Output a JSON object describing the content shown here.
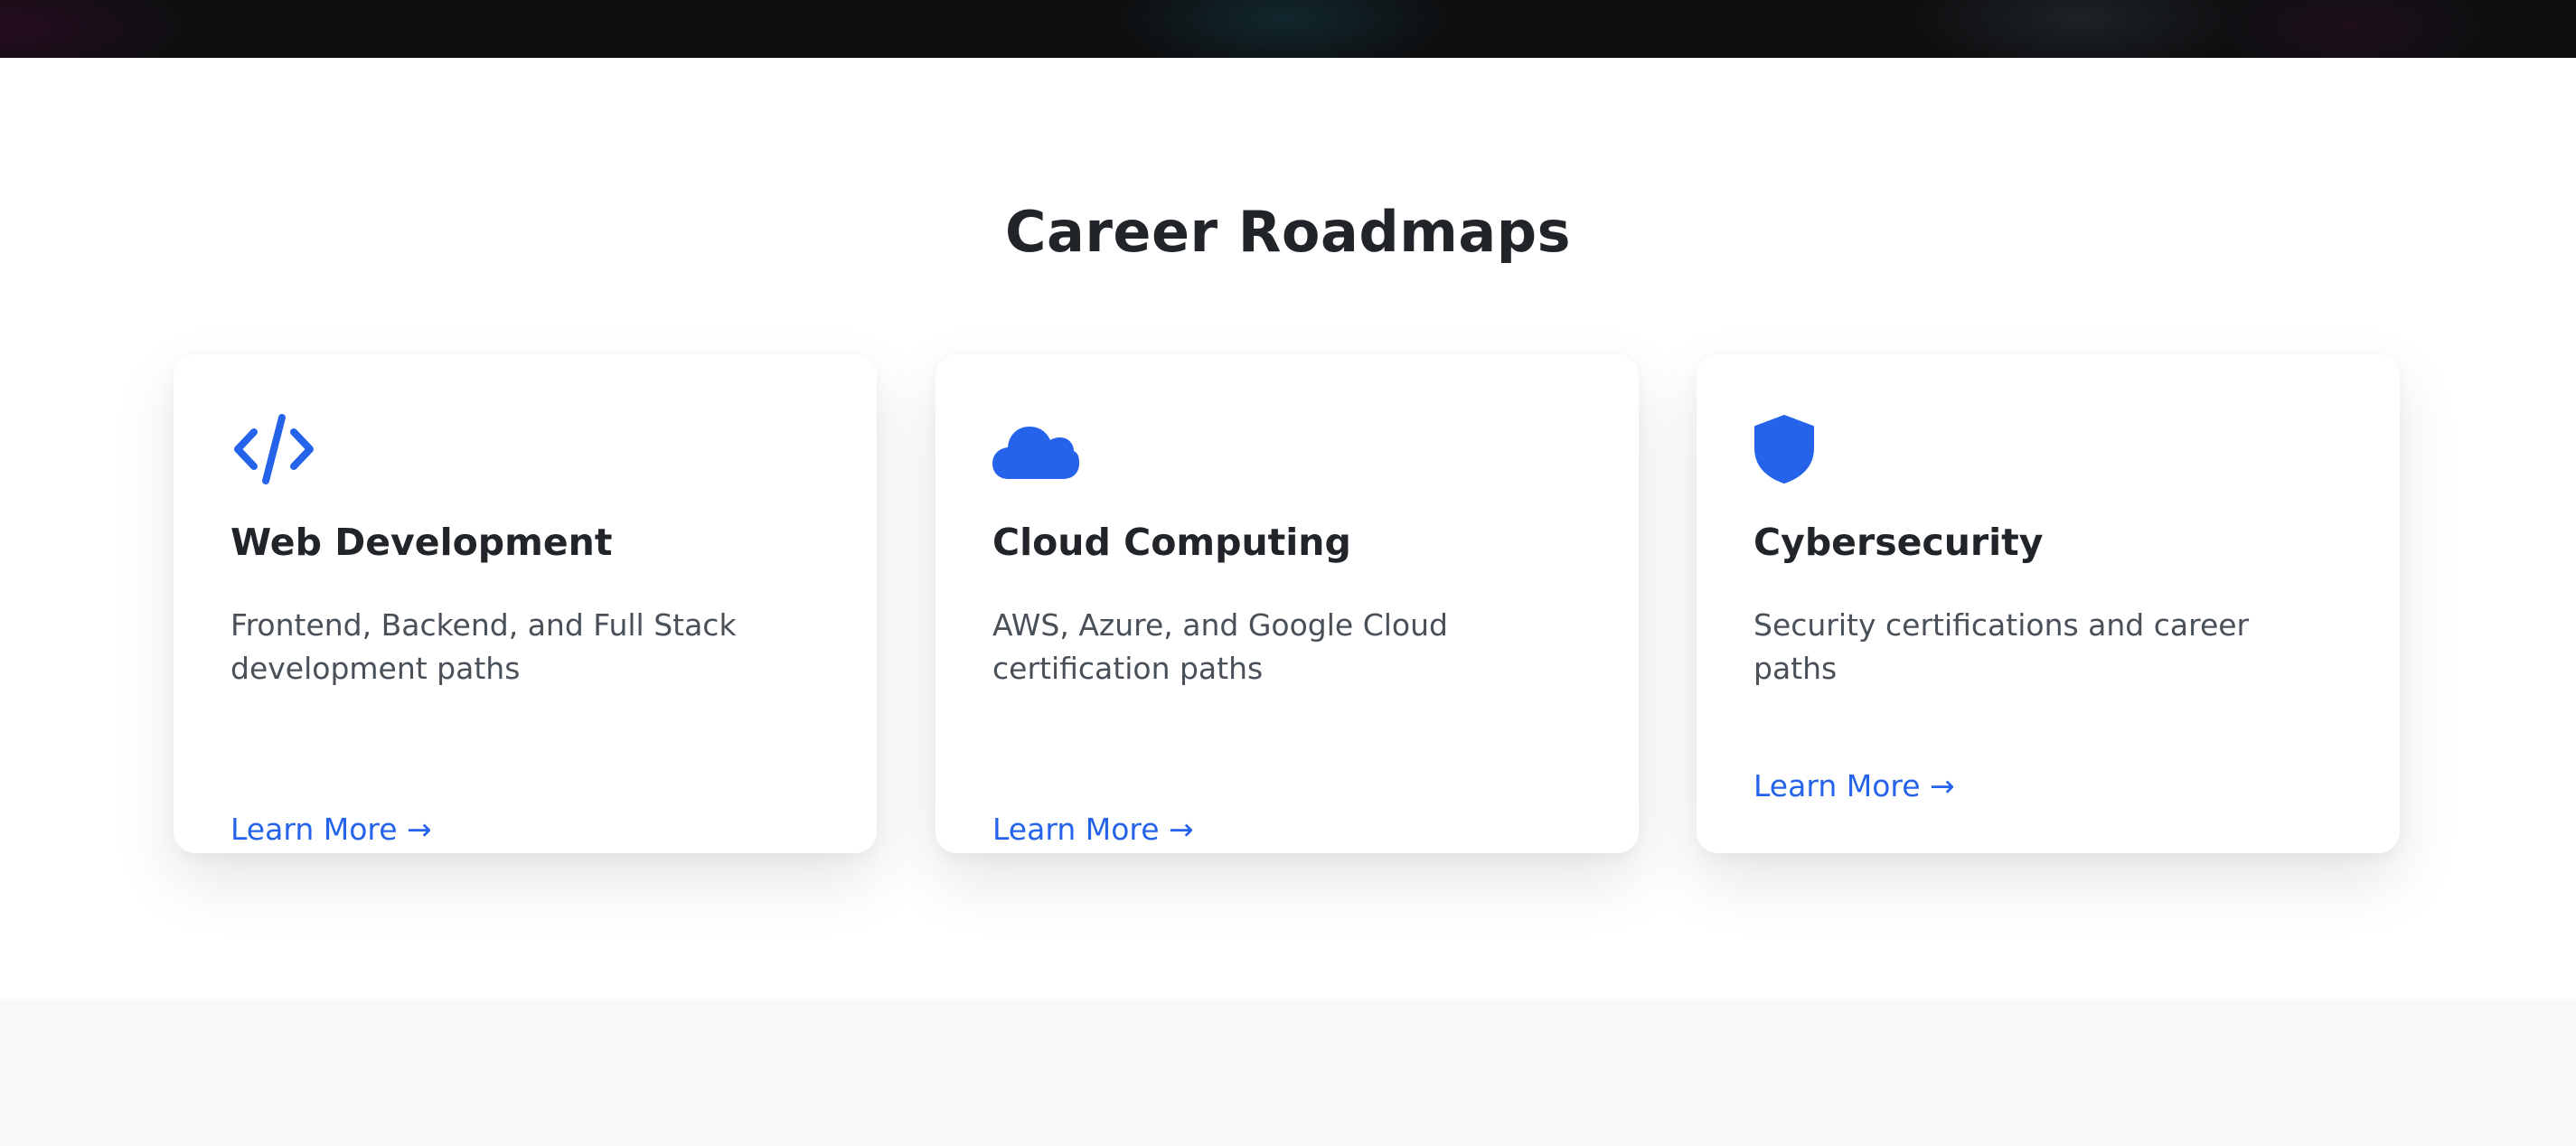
{
  "section": {
    "title": "Career Roadmaps"
  },
  "colors": {
    "accent": "#2563eb",
    "heading": "#212529",
    "body_text": "#495057",
    "top_bar": "#0e0f11",
    "bottom_band": "#f8f9fa"
  },
  "cards": [
    {
      "icon": "code-icon",
      "title": "Web Development",
      "description": "Frontend, Backend, and Full Stack development paths",
      "link_label": "Learn More →"
    },
    {
      "icon": "cloud-icon",
      "title": "Cloud Computing",
      "description": "AWS, Azure, and Google Cloud certification paths",
      "link_label": "Learn More →"
    },
    {
      "icon": "shield-icon",
      "title": "Cybersecurity",
      "description": "Security certifications and career paths",
      "link_label": "Learn More →"
    }
  ]
}
